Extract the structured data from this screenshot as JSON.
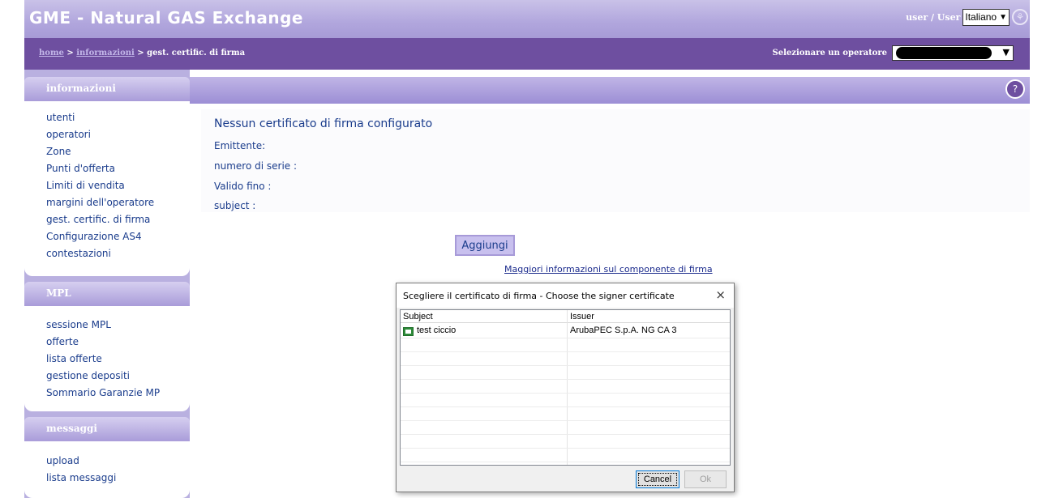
{
  "header": {
    "app_title": "GME - Natural GAS Exchange",
    "user_text": "user / User",
    "language": "Italiano"
  },
  "nav": {
    "breadcrumb_home": "home",
    "breadcrumb_sep1": " > ",
    "breadcrumb_info": "informazioni",
    "breadcrumb_sep2": " > gest. certific. di firma",
    "operator_label": "Selezionare un operatore"
  },
  "sidebar": {
    "informazioni": {
      "title": "informazioni",
      "items": [
        "utenti",
        "operatori",
        "Zone",
        "Punti d'offerta",
        "Limiti di vendita",
        "margini dell'operatore",
        "gest. certific. di firma",
        "Configurazione AS4",
        "contestazioni"
      ]
    },
    "mpl": {
      "title": "MPL",
      "items": [
        "sessione MPL",
        "offerte",
        "lista offerte",
        "gestione depositi",
        "Sommario Garanzie MP"
      ]
    },
    "messaggi": {
      "title": "messaggi",
      "items": [
        "upload",
        "lista messaggi"
      ]
    }
  },
  "main": {
    "cert_title": "Nessun certificato di firma configurato",
    "issuer_label": "Emittente:",
    "serial_label": "numero di serie :",
    "valid_label": "Valido fino :",
    "subject_label": "subject :",
    "add_button": "Aggiungi",
    "info_link": "Maggiori informazioni sul componente di firma"
  },
  "dialog": {
    "title": "Scegliere il certificato di firma - Choose the signer certificate",
    "close": "×",
    "columns": [
      "Subject",
      "Issuer"
    ],
    "rows": [
      {
        "subject": "test ciccio",
        "issuer": "ArubaPEC S.p.A. NG CA 3"
      }
    ],
    "cancel_button": "Cancel",
    "ok_button": "Ok"
  }
}
